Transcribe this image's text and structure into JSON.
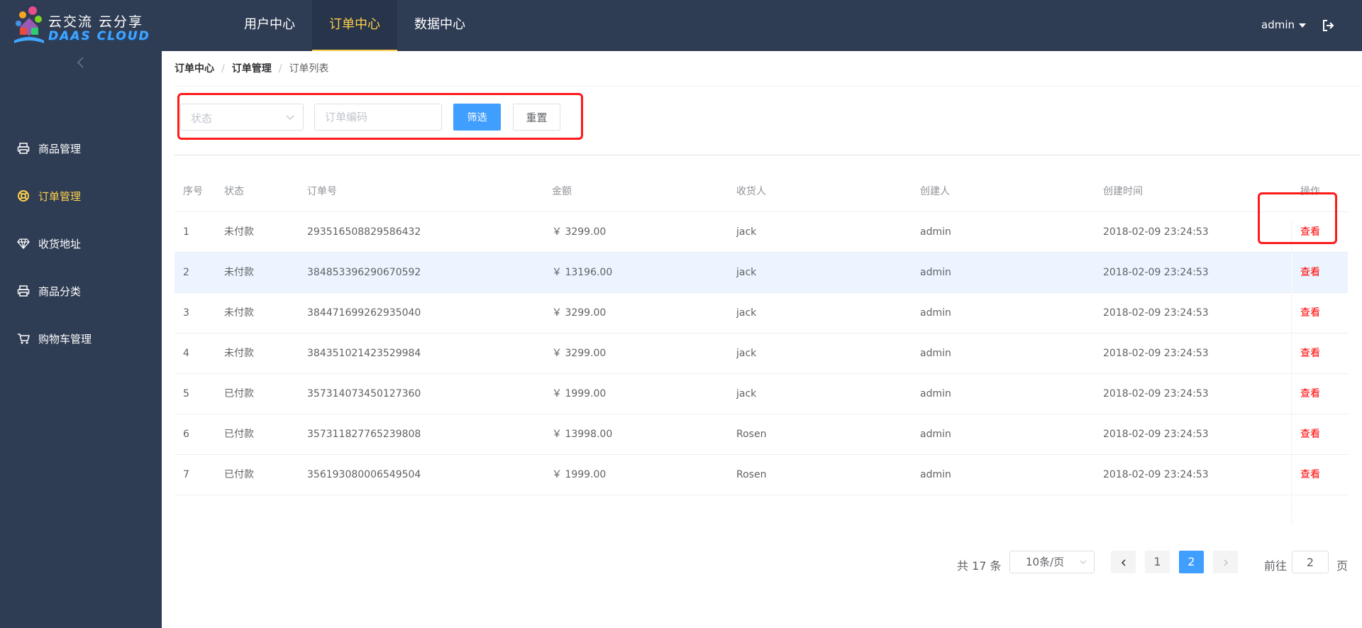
{
  "header": {
    "logo": {
      "line1": "云交流 云分享",
      "line2": "DAAS CLOUD"
    },
    "nav": [
      {
        "label": "用户中心"
      },
      {
        "label": "订单中心"
      },
      {
        "label": "数据中心"
      }
    ],
    "active_nav": "订单中心",
    "user": "admin"
  },
  "sidebar": {
    "items": [
      {
        "label": "商品管理",
        "icon": "printer-icon"
      },
      {
        "label": "订单管理",
        "icon": "lifebuoy-icon"
      },
      {
        "label": "收货地址",
        "icon": "diamond-icon"
      },
      {
        "label": "商品分类",
        "icon": "printer-icon"
      },
      {
        "label": "购物车管理",
        "icon": "cart-icon"
      }
    ],
    "active_item": "订单管理"
  },
  "breadcrumb": [
    "订单中心",
    "订单管理",
    "订单列表"
  ],
  "filter": {
    "status_placeholder": "状态",
    "code_placeholder": "订单编码",
    "filter_button": "筛选",
    "reset_button": "重置"
  },
  "table": {
    "headers": [
      "序号",
      "状态",
      "订单号",
      "金额",
      "收货人",
      "创建人",
      "创建时间",
      "操作"
    ],
    "rows": [
      [
        "1",
        "未付款",
        "293516508829586432",
        "￥ 3299.00",
        "jack",
        "admin",
        "2018-02-09 23:24:53",
        "查看"
      ],
      [
        "2",
        "未付款",
        "384853396290670592",
        "￥ 13196.00",
        "jack",
        "admin",
        "2018-02-09 23:24:53",
        "查看"
      ],
      [
        "3",
        "未付款",
        "384471699262935040",
        "￥ 3299.00",
        "jack",
        "admin",
        "2018-02-09 23:24:53",
        "查看"
      ],
      [
        "4",
        "未付款",
        "384351021423529984",
        "￥ 3299.00",
        "jack",
        "admin",
        "2018-02-09 23:24:53",
        "查看"
      ],
      [
        "5",
        "已付款",
        "357314073450127360",
        "￥ 1999.00",
        "jack",
        "admin",
        "2018-02-09 23:24:53",
        "查看"
      ],
      [
        "6",
        "已付款",
        "357311827765239808",
        "￥ 13998.00",
        "Rosen",
        "admin",
        "2018-02-09 23:24:53",
        "查看"
      ],
      [
        "7",
        "已付款",
        "356193080006549504",
        "￥ 1999.00",
        "Rosen",
        "admin",
        "2018-02-09 23:24:53",
        "查看"
      ]
    ],
    "hover_row": 2
  },
  "pagination": {
    "total_text": "共 17 条",
    "page_size": "10条/页",
    "pages": [
      "1",
      "2"
    ],
    "current_page": "2",
    "goto_prefix": "前往",
    "goto_value": "2",
    "goto_suffix": "页"
  },
  "colors": {
    "header_bg": "#2f3d54",
    "active_yellow": "#ffd04b",
    "primary": "#409eff",
    "annotation_red": "#ff1a1a",
    "link_red": "#ff0000"
  }
}
